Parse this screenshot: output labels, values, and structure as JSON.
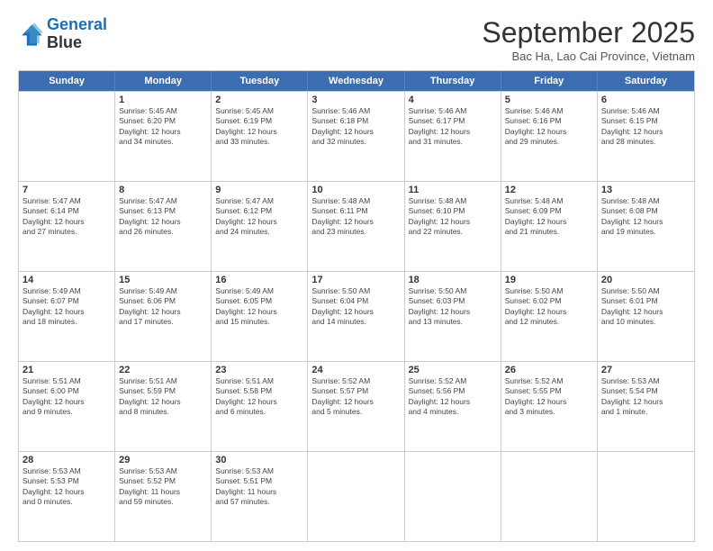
{
  "header": {
    "logo_line1": "General",
    "logo_line2": "Blue",
    "month_title": "September 2025",
    "subtitle": "Bac Ha, Lao Cai Province, Vietnam"
  },
  "days_of_week": [
    "Sunday",
    "Monday",
    "Tuesday",
    "Wednesday",
    "Thursday",
    "Friday",
    "Saturday"
  ],
  "weeks": [
    [
      {
        "day": "",
        "info": ""
      },
      {
        "day": "1",
        "info": "Sunrise: 5:45 AM\nSunset: 6:20 PM\nDaylight: 12 hours\nand 34 minutes."
      },
      {
        "day": "2",
        "info": "Sunrise: 5:45 AM\nSunset: 6:19 PM\nDaylight: 12 hours\nand 33 minutes."
      },
      {
        "day": "3",
        "info": "Sunrise: 5:46 AM\nSunset: 6:18 PM\nDaylight: 12 hours\nand 32 minutes."
      },
      {
        "day": "4",
        "info": "Sunrise: 5:46 AM\nSunset: 6:17 PM\nDaylight: 12 hours\nand 31 minutes."
      },
      {
        "day": "5",
        "info": "Sunrise: 5:46 AM\nSunset: 6:16 PM\nDaylight: 12 hours\nand 29 minutes."
      },
      {
        "day": "6",
        "info": "Sunrise: 5:46 AM\nSunset: 6:15 PM\nDaylight: 12 hours\nand 28 minutes."
      }
    ],
    [
      {
        "day": "7",
        "info": "Sunrise: 5:47 AM\nSunset: 6:14 PM\nDaylight: 12 hours\nand 27 minutes."
      },
      {
        "day": "8",
        "info": "Sunrise: 5:47 AM\nSunset: 6:13 PM\nDaylight: 12 hours\nand 26 minutes."
      },
      {
        "day": "9",
        "info": "Sunrise: 5:47 AM\nSunset: 6:12 PM\nDaylight: 12 hours\nand 24 minutes."
      },
      {
        "day": "10",
        "info": "Sunrise: 5:48 AM\nSunset: 6:11 PM\nDaylight: 12 hours\nand 23 minutes."
      },
      {
        "day": "11",
        "info": "Sunrise: 5:48 AM\nSunset: 6:10 PM\nDaylight: 12 hours\nand 22 minutes."
      },
      {
        "day": "12",
        "info": "Sunrise: 5:48 AM\nSunset: 6:09 PM\nDaylight: 12 hours\nand 21 minutes."
      },
      {
        "day": "13",
        "info": "Sunrise: 5:48 AM\nSunset: 6:08 PM\nDaylight: 12 hours\nand 19 minutes."
      }
    ],
    [
      {
        "day": "14",
        "info": "Sunrise: 5:49 AM\nSunset: 6:07 PM\nDaylight: 12 hours\nand 18 minutes."
      },
      {
        "day": "15",
        "info": "Sunrise: 5:49 AM\nSunset: 6:06 PM\nDaylight: 12 hours\nand 17 minutes."
      },
      {
        "day": "16",
        "info": "Sunrise: 5:49 AM\nSunset: 6:05 PM\nDaylight: 12 hours\nand 15 minutes."
      },
      {
        "day": "17",
        "info": "Sunrise: 5:50 AM\nSunset: 6:04 PM\nDaylight: 12 hours\nand 14 minutes."
      },
      {
        "day": "18",
        "info": "Sunrise: 5:50 AM\nSunset: 6:03 PM\nDaylight: 12 hours\nand 13 minutes."
      },
      {
        "day": "19",
        "info": "Sunrise: 5:50 AM\nSunset: 6:02 PM\nDaylight: 12 hours\nand 12 minutes."
      },
      {
        "day": "20",
        "info": "Sunrise: 5:50 AM\nSunset: 6:01 PM\nDaylight: 12 hours\nand 10 minutes."
      }
    ],
    [
      {
        "day": "21",
        "info": "Sunrise: 5:51 AM\nSunset: 6:00 PM\nDaylight: 12 hours\nand 9 minutes."
      },
      {
        "day": "22",
        "info": "Sunrise: 5:51 AM\nSunset: 5:59 PM\nDaylight: 12 hours\nand 8 minutes."
      },
      {
        "day": "23",
        "info": "Sunrise: 5:51 AM\nSunset: 5:58 PM\nDaylight: 12 hours\nand 6 minutes."
      },
      {
        "day": "24",
        "info": "Sunrise: 5:52 AM\nSunset: 5:57 PM\nDaylight: 12 hours\nand 5 minutes."
      },
      {
        "day": "25",
        "info": "Sunrise: 5:52 AM\nSunset: 5:56 PM\nDaylight: 12 hours\nand 4 minutes."
      },
      {
        "day": "26",
        "info": "Sunrise: 5:52 AM\nSunset: 5:55 PM\nDaylight: 12 hours\nand 3 minutes."
      },
      {
        "day": "27",
        "info": "Sunrise: 5:53 AM\nSunset: 5:54 PM\nDaylight: 12 hours\nand 1 minute."
      }
    ],
    [
      {
        "day": "28",
        "info": "Sunrise: 5:53 AM\nSunset: 5:53 PM\nDaylight: 12 hours\nand 0 minutes."
      },
      {
        "day": "29",
        "info": "Sunrise: 5:53 AM\nSunset: 5:52 PM\nDaylight: 11 hours\nand 59 minutes."
      },
      {
        "day": "30",
        "info": "Sunrise: 5:53 AM\nSunset: 5:51 PM\nDaylight: 11 hours\nand 57 minutes."
      },
      {
        "day": "",
        "info": ""
      },
      {
        "day": "",
        "info": ""
      },
      {
        "day": "",
        "info": ""
      },
      {
        "day": "",
        "info": ""
      }
    ]
  ]
}
